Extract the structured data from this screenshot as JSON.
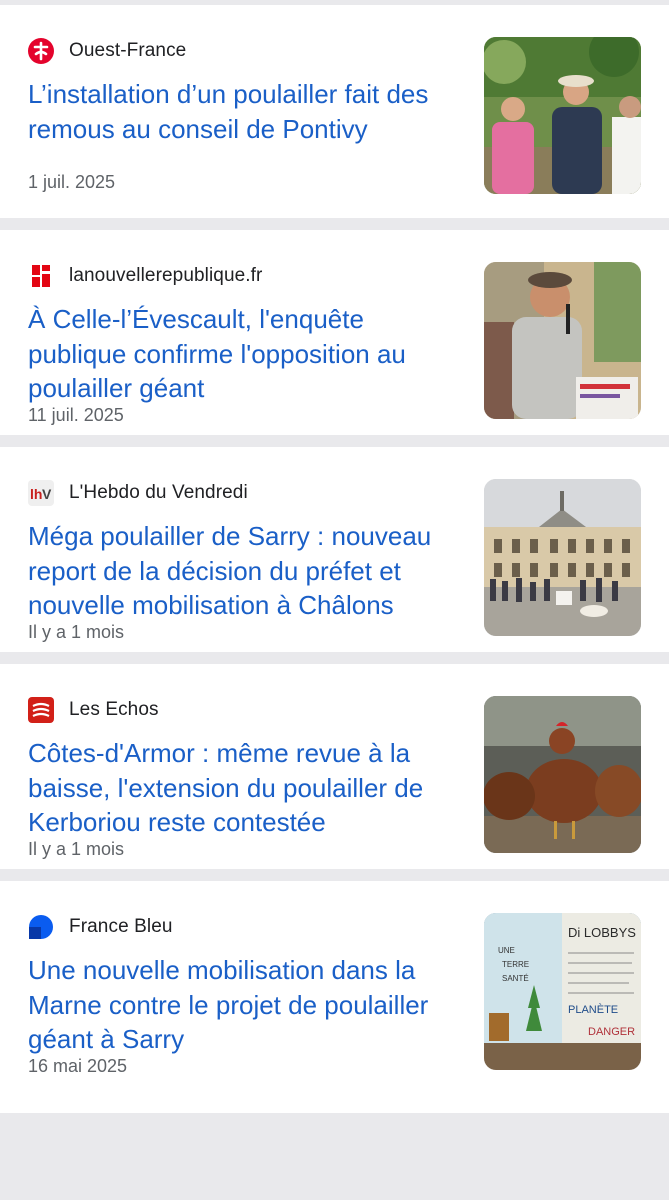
{
  "articles": [
    {
      "source": "Ouest-France",
      "logo_icon": "ouest-france-logo-icon",
      "logo_color": "#e4032c",
      "title": "L’installation d’un poulailler fait des remous au conseil de Pontivy",
      "date": "1 juil. 2025",
      "thumbnail_icon": "people-outdoor-photo"
    },
    {
      "source": "lanouvellerepublique.fr",
      "logo_icon": "nouvelle-republique-logo-icon",
      "logo_color": "#e30613",
      "title": "À Celle-l’Évescault, l'enquête publique confirme l'opposition au poulailler géant",
      "date": "11 juil. 2025",
      "thumbnail_icon": "man-with-microphone-photo"
    },
    {
      "source": "L'Hebdo du Vendredi",
      "logo_icon": "hebdo-du-vendredi-logo-icon",
      "logo_color": "#c8201e",
      "title": "Méga poulailler de Sarry : nouveau report de la décision du préfet et nouvelle mobilisation à Châlons",
      "date": "Il y a 1 mois",
      "thumbnail_icon": "prefecture-building-photo"
    },
    {
      "source": "Les Echos",
      "logo_icon": "les-echos-logo-icon",
      "logo_color": "#d22018",
      "title": "Côtes-d'Armor : même revue à la baisse, l'extension du poulailler de Kerboriou reste contestée",
      "date": "Il y a 1 mois",
      "thumbnail_icon": "hens-photo"
    },
    {
      "source": "France Bleu",
      "logo_icon": "france-bleu-logo-icon",
      "logo_color": "#0a5cf0",
      "title": "Une nouvelle mobilisation dans la Marne contre le projet de poulailler géant à Sarry",
      "date": "16 mai 2025",
      "thumbnail_icon": "protest-banner-photo",
      "banner_text": [
        "Di LOBBYS",
        "UNE",
        "TERRE",
        "SANTÉ",
        "PLANÈTE",
        "DANGER"
      ]
    }
  ]
}
